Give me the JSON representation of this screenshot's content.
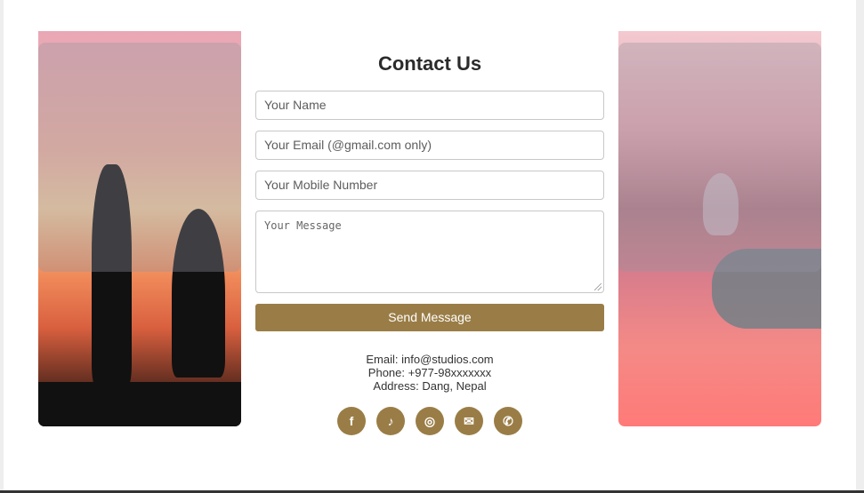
{
  "contact": {
    "title": "Contact Us",
    "name_placeholder": "Your Name",
    "email_placeholder": "Your Email (@gmail.com only)",
    "mobile_placeholder": "Your Mobile Number",
    "message_placeholder": "Your Message",
    "send_label": "Send Message",
    "email_line": "Email: info@studios.com",
    "phone_line": "Phone: +977-98xxxxxxx",
    "address_line": "Address: Dang, Nepal"
  },
  "social": [
    {
      "icon": "facebook-icon",
      "glyph": "f"
    },
    {
      "icon": "tiktok-icon",
      "glyph": "♪"
    },
    {
      "icon": "instagram-icon",
      "glyph": "◎"
    },
    {
      "icon": "email-icon",
      "glyph": "✉"
    },
    {
      "icon": "whatsapp-icon",
      "glyph": "✆"
    }
  ],
  "colors": {
    "accent": "#9a7d46",
    "title": "#2b2b2b"
  }
}
